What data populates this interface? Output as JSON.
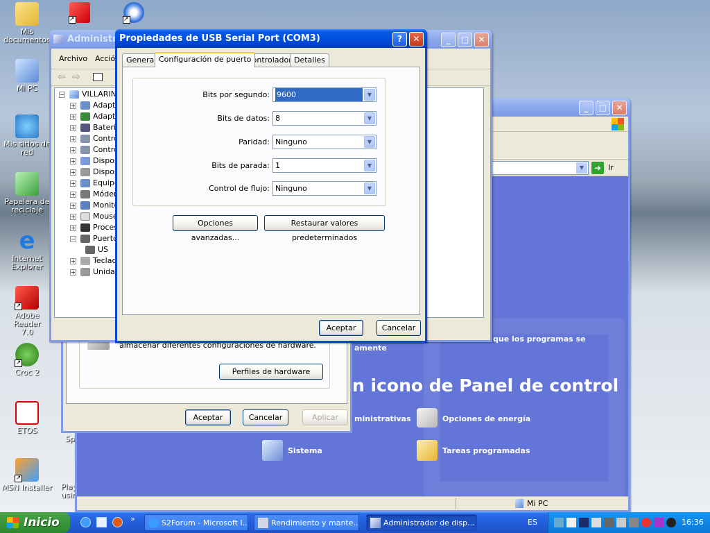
{
  "desktop": {
    "icons": [
      {
        "label": "Mis\ndocumentos"
      },
      {
        "label": "Mi PC"
      },
      {
        "label": "Mis sitios de\nred"
      },
      {
        "label": "Papelera de\nreciclaje"
      },
      {
        "label": "Internet\nExplorer"
      },
      {
        "label": "Adobe Reader\n7.0"
      },
      {
        "label": "Croc 2"
      },
      {
        "label": "ETOS"
      },
      {
        "label": "MSN Installer"
      },
      {
        "label": "Spe"
      },
      {
        "label": "Play\nusin"
      }
    ]
  },
  "control_panel": {
    "heading": "n icono de Panel de control",
    "address_go": "Ir",
    "text_right": "que los programas se",
    "text_left2": "amente",
    "links": {
      "admin": "ministrativas",
      "energia": "Opciones de energía",
      "sistema": "Sistema",
      "tareas": "Tareas programadas"
    },
    "status_mypc": "Mi PC"
  },
  "sysprops": {
    "hw_text": "almacenar diferentes configuraciones de hardware.",
    "hw_profiles_btn": "Perfiles de hardware",
    "ok": "Aceptar",
    "cancel": "Cancelar",
    "apply": "Aplicar"
  },
  "devmgr": {
    "title": "Administra",
    "menu": [
      "Archivo",
      "Acción"
    ],
    "tree_root": "VILLARIN",
    "tree": [
      "Adapt",
      "Adapt",
      "Baterí",
      "Contro",
      "Contro",
      "Dispos",
      "Dispos",
      "Equipo",
      "Móder",
      "Monito",
      "Mouse",
      "Proces",
      "Puerto",
      "US",
      "Teclad",
      "Unidad"
    ]
  },
  "dialog": {
    "title": "Propiedades de USB Serial Port (COM3)",
    "tabs": [
      "General",
      "Configuración de puerto",
      "Controlador",
      "Detalles"
    ],
    "fields": [
      {
        "label": "Bits por segundo:",
        "value": "9600"
      },
      {
        "label": "Bits de datos:",
        "value": "8"
      },
      {
        "label": "Paridad:",
        "value": "Ninguno"
      },
      {
        "label": "Bits de parada:",
        "value": "1"
      },
      {
        "label": "Control de flujo:",
        "value": "Ninguno"
      }
    ],
    "advanced_btn": "Opciones avanzadas...",
    "restore_btn": "Restaurar valores predeterminados",
    "ok": "Aceptar",
    "cancel": "Cancelar"
  },
  "taskbar": {
    "start": "Inicio",
    "items": [
      "S2Forum - Microsoft I...",
      "Rendimiento y mante...",
      "Administrador de disp..."
    ],
    "lang": "ES",
    "clock": "16:36"
  }
}
